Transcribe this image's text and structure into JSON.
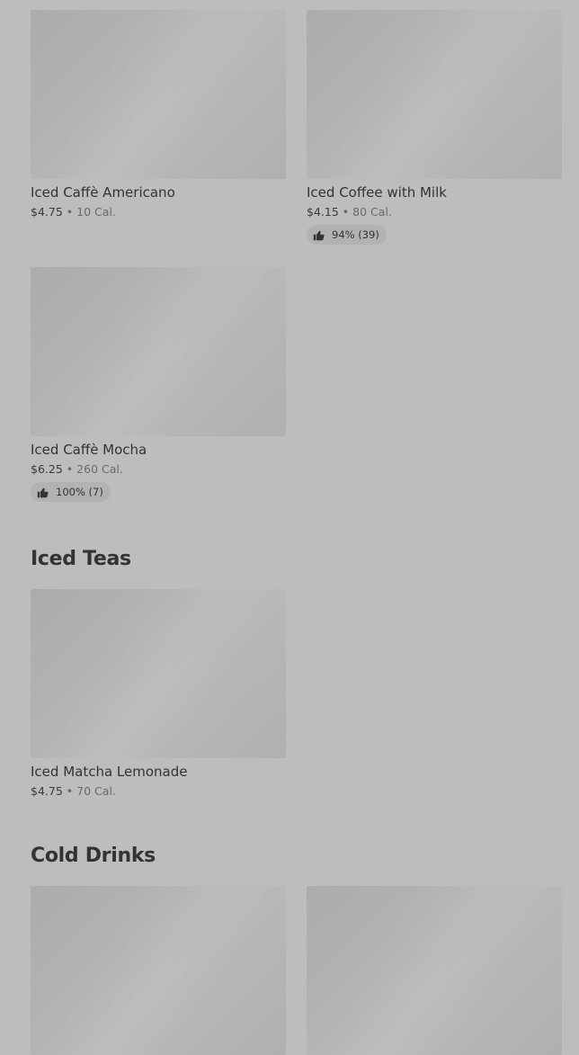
{
  "sections": [
    {
      "title": "",
      "items": [
        {
          "name": "Iced Caffè Americano",
          "price": "$4.75",
          "calories": "10 Cal.",
          "rating": ""
        },
        {
          "name": "Iced Coffee with Milk",
          "price": "$4.15",
          "calories": "80 Cal.",
          "rating": "94% (39)"
        },
        {
          "name": "Iced Caffè Mocha",
          "price": "$6.25",
          "calories": "260 Cal.",
          "rating": "100% (7)"
        }
      ]
    },
    {
      "title": "Iced Teas",
      "items": [
        {
          "name": "Iced Matcha Lemonade",
          "price": "$4.75",
          "calories": "70 Cal.",
          "rating": ""
        }
      ]
    },
    {
      "title": "Cold Drinks",
      "items": [
        {
          "name": "",
          "price": "",
          "calories": "",
          "rating": ""
        },
        {
          "name": "",
          "price": "",
          "calories": "",
          "rating": ""
        }
      ]
    }
  ],
  "separator": "•",
  "icons": {
    "rating": "thumbs-up-icon"
  },
  "colors": {
    "background": "#bdbdbd",
    "image_placeholder": "#b0b0b0",
    "rating_pill": "#b2b2b2",
    "text": "#333333"
  }
}
